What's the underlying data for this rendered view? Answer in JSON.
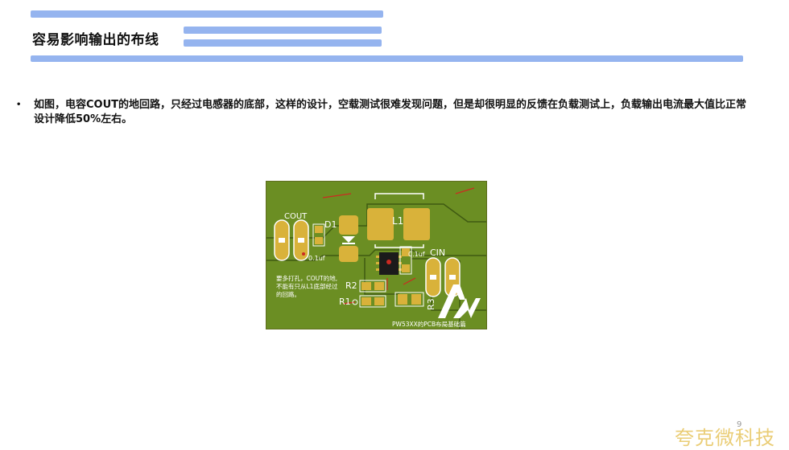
{
  "slide": {
    "title": "容易影响输出的布线",
    "bullet_text": "如图，电容COUT的地回路，只经过电感器的底部，这样的设计，空载测试很难发现问题，但是却很明显的反馈在负载测试上，负载输出电流最大值比正常设计降低50%左右。",
    "page_number": "9",
    "watermark": "夸克微科技",
    "accent_color": "#8fb0ee"
  },
  "pcb_figure": {
    "board_color": "#6b8e23",
    "label_cout": "COUT",
    "label_d1": "D1",
    "label_l1": "L1",
    "label_cin": "CIN",
    "label_r2": "R2",
    "label_r1": "R1",
    "label_r3": "R3",
    "label_cap_left": "0.1uf",
    "label_cap_mid": "0.1uf",
    "note_line1": "要多打孔，COUT的地,",
    "note_line2": "不能有只从L1底部经过",
    "note_line3": "的回路。",
    "caption": "PW53XX的PCB布局基础篇"
  }
}
